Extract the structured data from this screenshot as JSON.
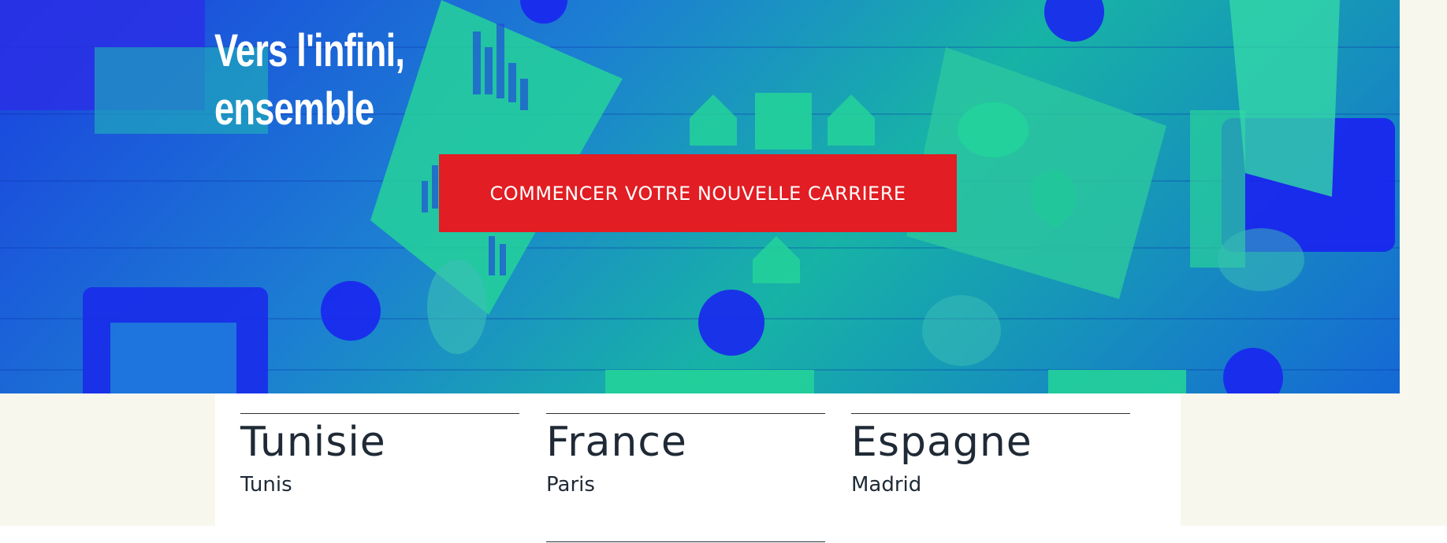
{
  "hero": {
    "title_line1": "Vers l'infini,",
    "title_line2": "ensemble",
    "cta_label": "COMMENCER VOTRE NOUVELLE CARRIERE"
  },
  "locations": [
    {
      "country": "Tunisie",
      "city": "Tunis"
    },
    {
      "country": "France",
      "city": "Paris"
    },
    {
      "country": "Espagne",
      "city": "Madrid"
    }
  ],
  "colors": {
    "cta": "#e21d23",
    "hero_blue": "#1a3fe0",
    "hero_green": "#17b3a6",
    "text_dark": "#1f2a36",
    "page_bg": "#f7f7ee"
  }
}
